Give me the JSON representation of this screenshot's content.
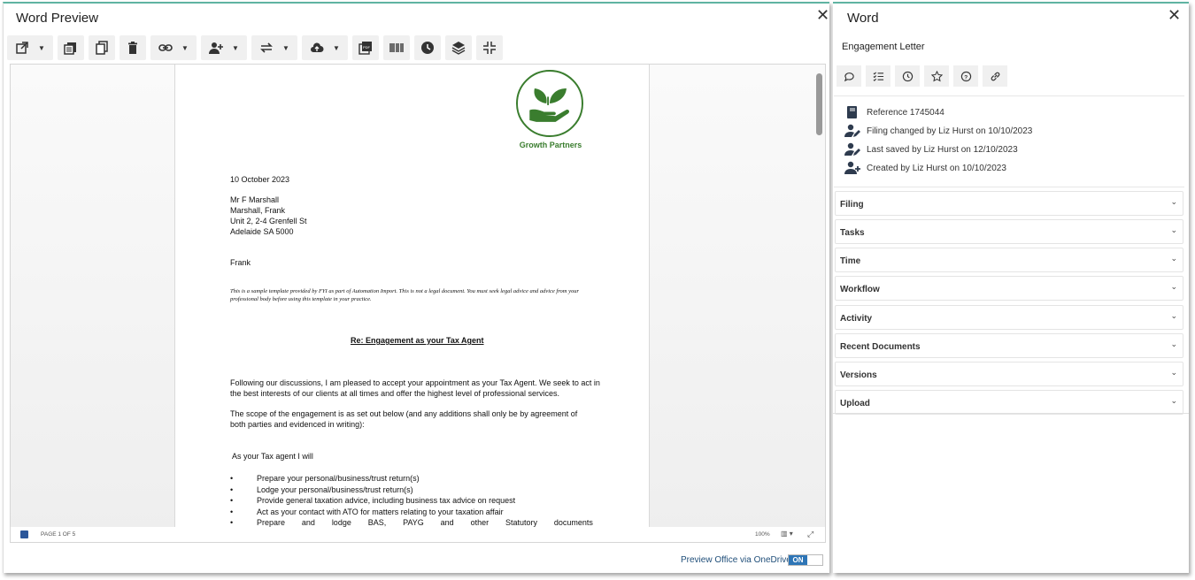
{
  "left": {
    "title": "Word Preview",
    "close": "✕",
    "toolbar": [
      {
        "icon": "open-external-icon",
        "dropdown": true
      },
      {
        "icon": "copy-stack-icon",
        "dropdown": false
      },
      {
        "icon": "duplicate-icon",
        "dropdown": false
      },
      {
        "icon": "trash-icon",
        "dropdown": false
      },
      {
        "icon": "link-icon",
        "dropdown": true
      },
      {
        "icon": "add-user-icon",
        "dropdown": true
      },
      {
        "icon": "transfer-icon",
        "dropdown": true
      },
      {
        "icon": "cloud-upload-icon",
        "dropdown": true
      },
      {
        "icon": "pdf-icon",
        "dropdown": false
      },
      {
        "icon": "barcode-icon",
        "dropdown": false
      },
      {
        "icon": "clock-icon",
        "dropdown": false
      },
      {
        "icon": "layers-icon",
        "dropdown": false
      },
      {
        "icon": "collapse-icon",
        "dropdown": false
      }
    ],
    "document": {
      "logo_text": "Growth Partners",
      "date": "10 October 2023",
      "address": [
        "Mr F Marshall",
        "Marshall, Frank",
        "Unit 2, 2-4 Grenfell St",
        "Adelaide SA 5000"
      ],
      "salutation": "Frank",
      "note": "This is a sample template provided by FYI as part of Automation Import. This is not a legal document. You must seek legal advice and advice from your professional body before using this template in your practice.",
      "subject": "Re: Engagement as your Tax Agent",
      "para1_line1": "Following our discussions, I am pleased to accept your appointment as your Tax Agent.  We seek to act in",
      "para1_line2": "the best interests of our clients at all times and offer the highest level of professional services.",
      "para2_line1": "The scope of the engagement is as set out below (and any additions shall only be by agreement of",
      "para2_line2": "both parties and evidenced in writing):",
      "list_intro": "As your Tax agent I will",
      "bullets": [
        "Prepare your personal/business/trust return(s)",
        "Lodge your personal/business/trust return(s)",
        "Provide general taxation advice, including business tax advice on request",
        "Act as your contact with ATO for matters relating to your taxation affair"
      ],
      "last_bullet_words": [
        "Prepare",
        "and",
        "lodge",
        "BAS,",
        "PAYG",
        "and",
        "other",
        "Statutory",
        "documents"
      ]
    },
    "statusbar": {
      "page": "PAGE 1 OF 5",
      "zoom": "100%"
    },
    "preview_label": "Preview Office via OneDrive",
    "toggle": "ON"
  },
  "right": {
    "title": "Word",
    "close": "✕",
    "doc_name": "Engagement Letter",
    "toolbar": [
      "comment-icon",
      "checklist-icon",
      "history-icon",
      "star-icon",
      "help-icon",
      "link-icon"
    ],
    "info": [
      {
        "icon": "book-icon",
        "text": "Reference 1745044"
      },
      {
        "icon": "user-edit-icon",
        "text": "Filing changed by Liz Hurst on 10/10/2023"
      },
      {
        "icon": "user-edit-icon",
        "text": "Last saved by Liz Hurst on 12/10/2023"
      },
      {
        "icon": "user-add-icon",
        "text": "Created by Liz Hurst on 10/10/2023"
      }
    ],
    "sections": [
      "Filing",
      "Tasks",
      "Time",
      "Workflow",
      "Activity",
      "Recent Documents",
      "Versions",
      "Upload"
    ]
  }
}
